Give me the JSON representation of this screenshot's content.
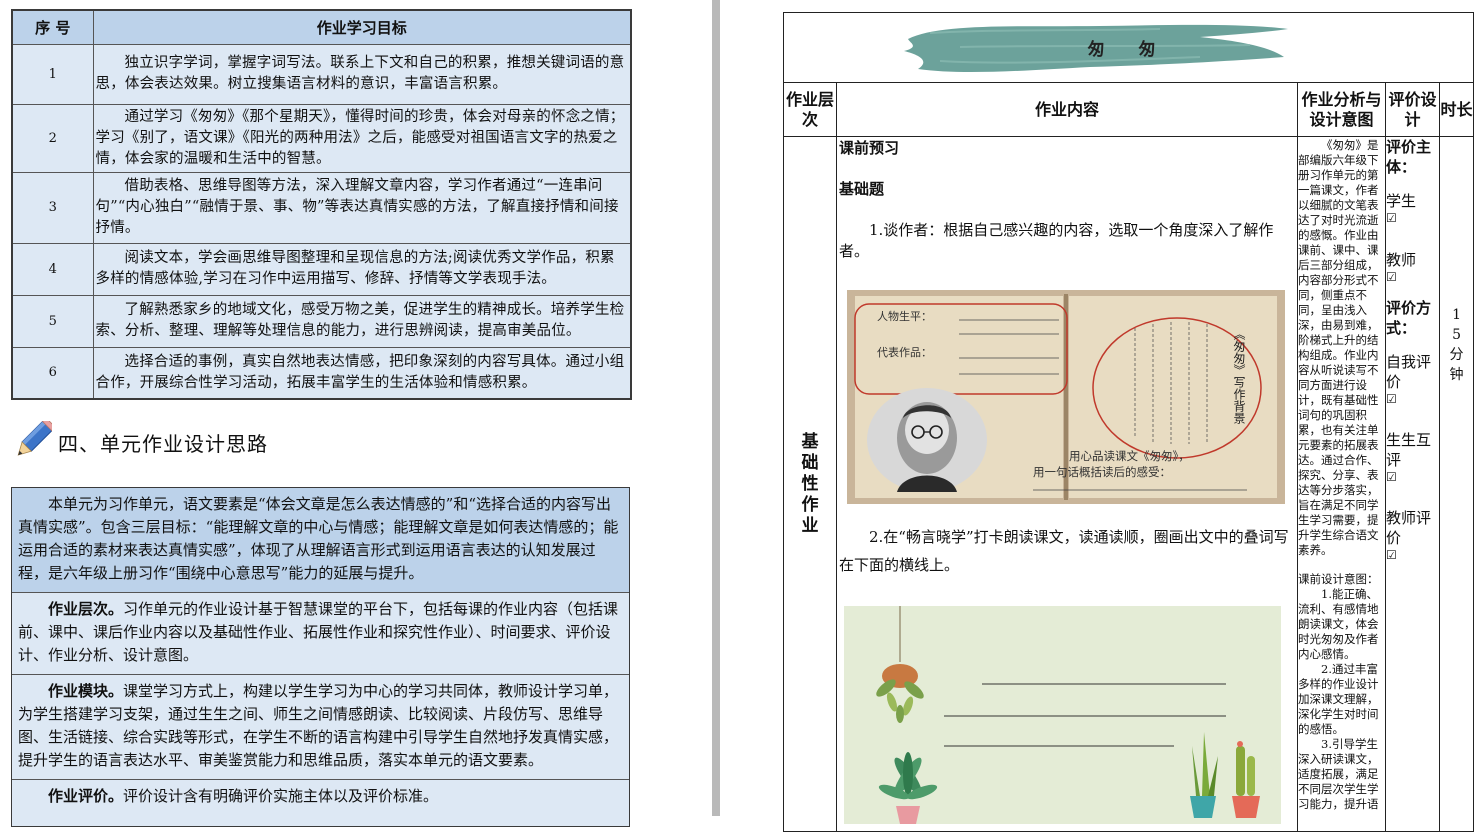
{
  "goal_table": {
    "headers": [
      "序 号",
      "作业学习目标"
    ],
    "rows": [
      {
        "num": "1",
        "text": "独立识字学词，掌握字词写法。联系上下文和自己的积累，推想关键词语的意思，体会表达效果。树立搜集语言材料的意识，丰富语言积累。"
      },
      {
        "num": "2",
        "text": "通过学习《匆匆》《那个星期天》，懂得时间的珍贵，体会对母亲的怀念之情；学习《别了，语文课》《阳光的两种用法》之后，能感受对祖国语言文字的热爱之情，体会家的温暖和生活中的智慧。"
      },
      {
        "num": "3",
        "text": "借助表格、思维导图等方法，深入理解文章内容，学习作者通过“一连串问句”“内心独白”“融情于景、事、物”等表达真情实感的方法，了解直接抒情和间接抒情。"
      },
      {
        "num": "4",
        "text": "阅读文本，学会画思维导图整理和呈现信息的方法;阅读优秀文学作品，积累多样的情感体验,学习在习作中运用描写、修辞、抒情等文学表现手法。"
      },
      {
        "num": "5",
        "text": "了解熟悉家乡的地域文化，感受万物之美，促进学生的精神成长。培养学生检索、分析、整理、理解等处理信息的能力，进行思辨阅读，提高审美品位。"
      },
      {
        "num": "6",
        "text": "选择合适的事例，真实自然地表达情感，把印象深刻的内容写具体。通过小组合作，开展综合性学习活动，拓展丰富学生的生活体验和情感积累。"
      }
    ]
  },
  "section": {
    "title": "四、单元作业设计思路",
    "icon": "pencil-icon"
  },
  "design_ideas": {
    "intro": "本单元为习作单元，语文要素是“体会文章是怎么表达情感的”和“选择合适的内容写出真情实感”。包含三层目标：“能理解文章的中心与情感；能理解文章是如何表达情感的；能运用合适的素材来表达真情实感”，体现了从理解语言形式到运用语言表达的认知发展过程，是六年级上册习作“围绕中心意思写”能力的延展与提升。",
    "levels_label": "作业层次。",
    "levels_text": "习作单元的作业设计基于智慧课堂的平台下，包括每课的作业内容（包括课前、课中、课后作业内容以及基础性作业、拓展性作业和探究性作业）、时间要求、评价设计、作业分析、设计意图。",
    "modules_label": "作业模块。",
    "modules_text": "课堂学习方式上，构建以学生学习为中心的学习共同体，教师设计学习单，为学生搭建学习支架，通过生生之间、师生之间情感朗读、比较阅读、片段仿写、思维导图、生活链接、综合实践等形式，在学生不断的语言构建中引导学生自然地抒发真情实感，提升学生的语言表达水平、审美鉴赏能力和思维品质，落实本单元的语文要素。",
    "eval_label": "作业评价。",
    "eval_text": "评价设计含有明确评价实施主体以及评价标准。"
  },
  "homework_table": {
    "banner_title": "匆 匆",
    "headers": {
      "level": "作业层次",
      "content": "作业内容",
      "analysis": "作业分析与设计意图",
      "evaluation": "评价设计",
      "time": "时长"
    },
    "level_label": [
      "基",
      "础",
      "性",
      "作",
      "业"
    ],
    "content": {
      "pre_class": "课前预习",
      "basic": "基础题",
      "q1": "1.谈作者：根据自己感兴趣的内容，选取一个角度深入了解作者。",
      "q2": "2.在“畅言晓学”打卡朗读课文，读通读顺，圈画出文中的叠词写在下面的横线上。",
      "book_card": {
        "life_label": "人物生平：",
        "works_label": "代表作品：",
        "circle_title": "《匆匆》写作背景",
        "prompt_line1": "用心品读课文《匆匆》，",
        "prompt_line2": "用一句话概括读后的感受："
      }
    },
    "analysis": {
      "p1": "《匆匆》是部编版六年级下册习作单元的第一篇课文，作者以细腻的文笔表达了对时光流逝的感慨。作业由课前、课中、课后三部分组成，内容部分形式不同，侧重点不同，呈由浅入深，由易到难，阶梯式上升的结构组成。作业内容从听说读写不同方面进行设计，既有基础性词句的巩固积累，也有关注单元要素的拓展表达。通过合作、探究、分享、表达等分步落实，旨在满足不同学生学习需要，提升学生综合语文素养。",
      "p2_title": "课前设计意图：",
      "p2_1": "1.能正确、流利、有感情地朗读课文，体会时光匆匆及作者内心感情。",
      "p2_2": "2.通过丰富多样的作业设计加深课文理解，深化学生对时间的感悟。",
      "p2_3": "3.引导学生深入研读课文，适度拓展，满足不同层次学生学习能力，提升语"
    },
    "evaluation": {
      "subject_label": "评价主体：",
      "student": "学生",
      "teacher": "教师",
      "method_label": "评价方式：",
      "self": "自我评价",
      "peer": "生生互评",
      "teacher_eval": "教师评价",
      "check_glyph": "☑"
    },
    "time": "15分钟"
  },
  "colors": {
    "table_header_blue": "#bcd2ea",
    "table_cell_blue": "#dde8f4",
    "banner_teal": "#5f9a92",
    "book_brown": "#c9b59a",
    "circle_red": "#c0392b",
    "plant_bg": "#e4ecd6"
  }
}
